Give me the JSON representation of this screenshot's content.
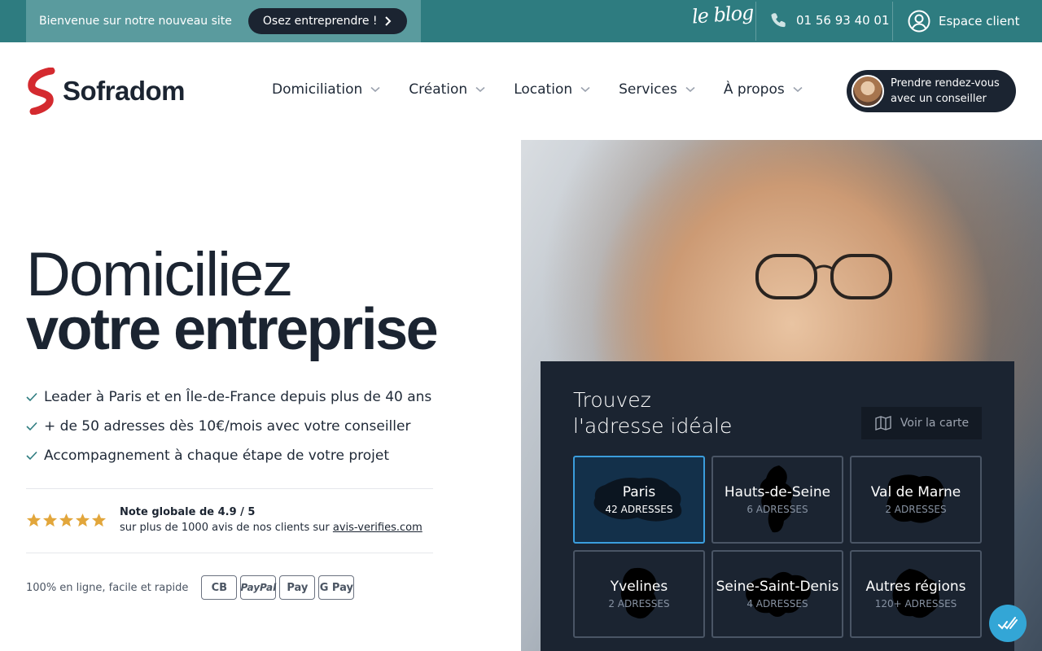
{
  "topbar": {
    "welcome": "Bienvenue sur notre nouveau site",
    "cta": "Osez entreprendre !",
    "blog": "le blog",
    "phone": "01 56 93 40 01",
    "client_area": "Espace client"
  },
  "header": {
    "logo": "Sofradom",
    "nav": [
      "Domiciliation",
      "Création",
      "Location",
      "Services",
      "À propos"
    ],
    "appointment_line1": "Prendre rendez-vous",
    "appointment_line2": "avec un conseiller"
  },
  "hero": {
    "title_line1": "Domiciliez",
    "title_line2": "votre entreprise",
    "benefits": [
      "Leader à Paris et en Île-de-France depuis plus de 40 ans",
      "+ de 50 adresses dès 10€/mois avec votre conseiller",
      "Accompagnement à chaque étape de votre projet"
    ],
    "rating_title": "Note globale de 4.9 / 5",
    "rating_sub": "sur plus de 1000 avis de nos clients sur",
    "rating_link": "avis-verifies.com",
    "rating_stars": 5,
    "payment_label": "100% en ligne, facile et rapide",
    "payment_methods": [
      "CB",
      "PayPal",
      "Pay",
      "G Pay"
    ]
  },
  "finder": {
    "title_line1": "Trouvez",
    "title_line2": "l'adresse idéale",
    "map_button": "Voir la carte",
    "regions": [
      {
        "name": "Paris",
        "count": "42 adresses",
        "active": true
      },
      {
        "name": "Hauts-de-Seine",
        "count": "6 adresses",
        "active": false
      },
      {
        "name": "Val de Marne",
        "count": "2 adresses",
        "active": false
      },
      {
        "name": "Yvelines",
        "count": "2 adresses",
        "active": false
      },
      {
        "name": "Seine-Saint-Denis",
        "count": "4 adresses",
        "active": false
      },
      {
        "name": "Autres régions",
        "count": "120+ adresses",
        "active": false
      }
    ]
  },
  "colors": {
    "topbar": "#2e7c80",
    "dark": "#1b2431",
    "accent_red": "#d42a2f",
    "accent_blue": "#3b9ddc",
    "star": "#e2a63b"
  },
  "icons": [
    "chevron-right-icon",
    "phone-icon",
    "user-icon",
    "chevron-down-icon",
    "check-icon",
    "star-icon",
    "map-icon",
    "chat-icon"
  ]
}
